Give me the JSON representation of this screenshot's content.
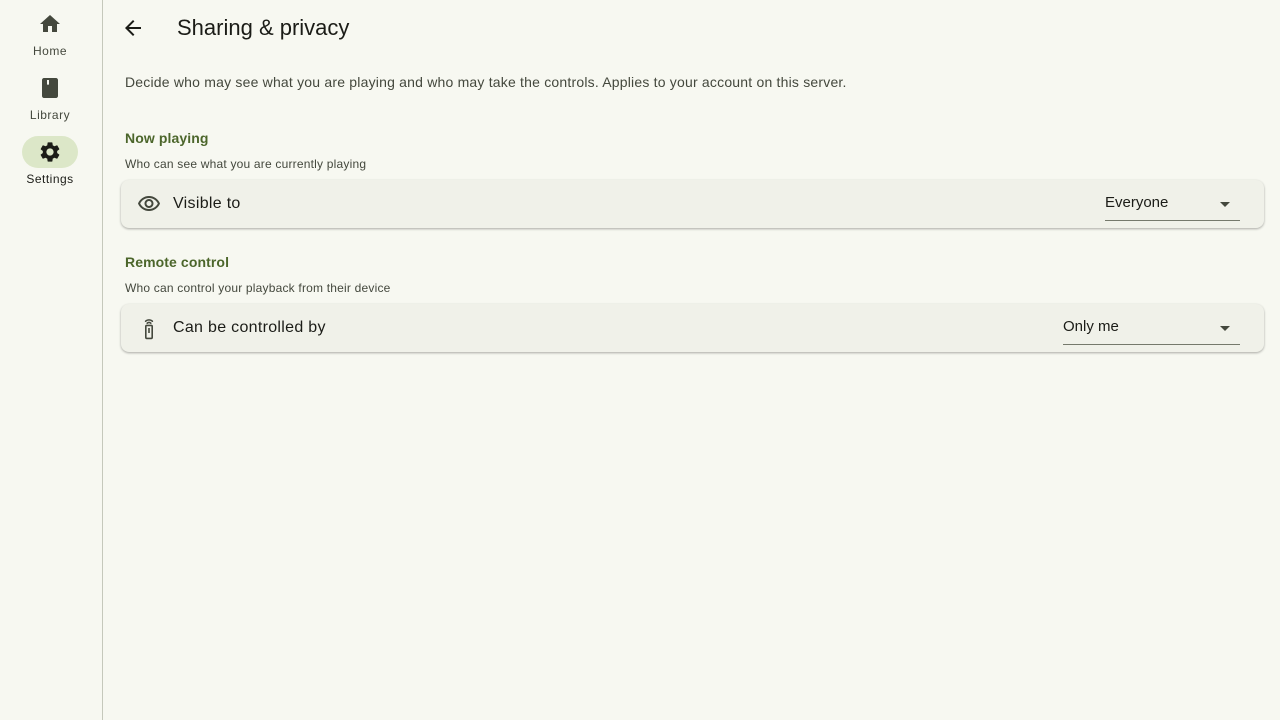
{
  "nav": {
    "items": [
      {
        "label": "Home",
        "icon": "home-icon",
        "active": false
      },
      {
        "label": "Library",
        "icon": "book-icon",
        "active": false
      },
      {
        "label": "Settings",
        "icon": "gear-icon",
        "active": true
      }
    ]
  },
  "header": {
    "title": "Sharing & privacy",
    "back_icon": "arrow-back-icon"
  },
  "intro": "Decide who may see what you are playing and who may take the controls. Applies to your account on this server.",
  "sections": [
    {
      "title": "Now playing",
      "subtitle": "Who can see what you are currently playing",
      "row": {
        "icon": "eye-icon",
        "label": "Visible to",
        "value": "Everyone"
      }
    },
    {
      "title": "Remote control",
      "subtitle": "Who can control your playback from their device",
      "row": {
        "icon": "remote-icon",
        "label": "Can be controlled by",
        "value": "Only me"
      }
    }
  ],
  "colors": {
    "background": "#f7f8f1",
    "accent": "#4c662b",
    "active_indicator": "#dce7c8",
    "card": "#f0f1e9"
  }
}
